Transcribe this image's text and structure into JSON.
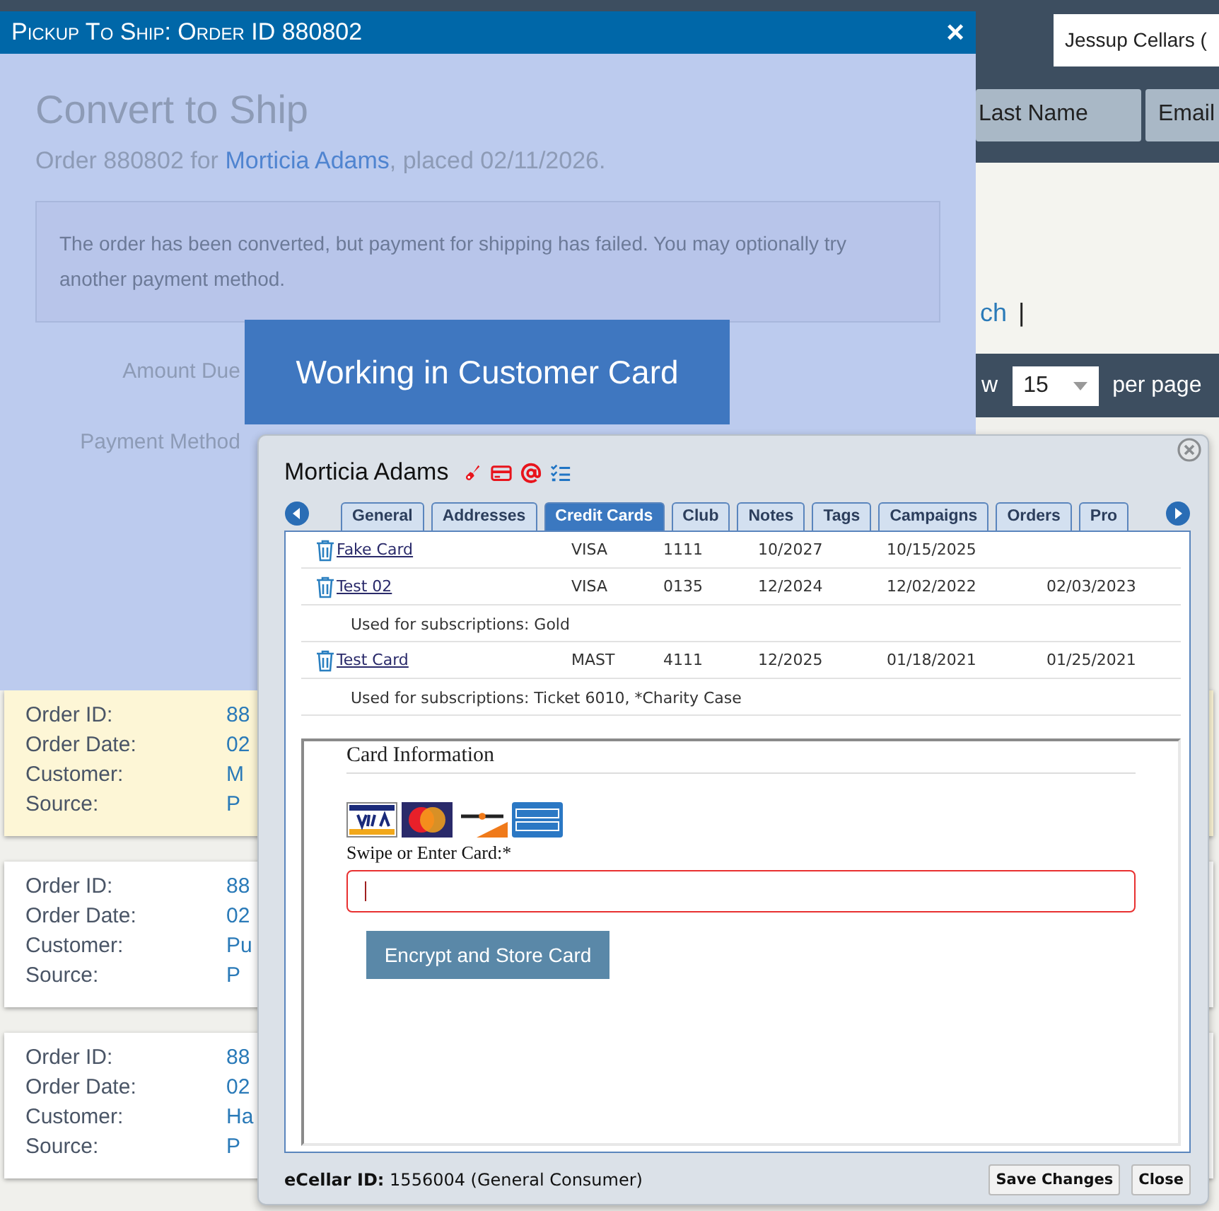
{
  "page": {
    "account_field": {
      "value": "Jessup Cellars ("
    },
    "search_tabs": [
      {
        "label": "Last Name"
      },
      {
        "label": "Email"
      }
    ],
    "link_fragment": "ch",
    "separator": "|",
    "pager": {
      "prefix": "w",
      "per_page": "15",
      "suffix": "per page"
    },
    "order_cards": [
      {
        "highlighted": true,
        "fields": [
          {
            "label": "Order ID:",
            "value": "88"
          },
          {
            "label": "Order Date:",
            "value": "02"
          },
          {
            "label": "Customer:",
            "value": "M"
          },
          {
            "label": "Source:",
            "value": "P"
          }
        ]
      },
      {
        "highlighted": false,
        "fields": [
          {
            "label": "Order ID:",
            "value": "88"
          },
          {
            "label": "Order Date:",
            "value": "02"
          },
          {
            "label": "Customer:",
            "value": "Pu"
          },
          {
            "label": "Source:",
            "value": "P"
          }
        ]
      },
      {
        "highlighted": false,
        "fields": [
          {
            "label": "Order ID:",
            "value": "88"
          },
          {
            "label": "Order Date:",
            "value": "02"
          },
          {
            "label": "Customer:",
            "value": "Ha"
          },
          {
            "label": "Source:",
            "value": "P"
          }
        ]
      }
    ]
  },
  "pickup_dialog": {
    "title": "Pickup To Ship: Order ID 880802",
    "close": "×",
    "heading": "Convert to Ship",
    "summary": {
      "before": "Order 880802 for ",
      "customer": "Morticia Adams",
      "after": ", placed 02/11/2026."
    },
    "alert": "The order has been converted, but payment for shipping has failed. You may optionally try another payment method.",
    "fields": [
      {
        "label": "Amount Due"
      },
      {
        "label": "Payment Method"
      }
    ]
  },
  "status_banner": "Working in Customer Card",
  "customer_card": {
    "name": "Morticia Adams",
    "tabs": [
      {
        "label": "General",
        "selected": false
      },
      {
        "label": "Addresses",
        "selected": false
      },
      {
        "label": "Credit Cards",
        "selected": true
      },
      {
        "label": "Club",
        "selected": false
      },
      {
        "label": "Notes",
        "selected": false
      },
      {
        "label": "Tags",
        "selected": false
      },
      {
        "label": "Campaigns",
        "selected": false
      },
      {
        "label": "Orders",
        "selected": false
      },
      {
        "label": "Pro",
        "selected": false
      }
    ],
    "cards": [
      {
        "cells": [
          "Fake Card",
          "VISA",
          "1111",
          "10/2027",
          "10/15/2025"
        ]
      },
      {
        "cells": [
          "Test 02",
          "VISA",
          "0135",
          "12/2024",
          "12/02/2022",
          "02/03/2023"
        ],
        "note": "Used for subscriptions: Gold"
      },
      {
        "cells": [
          "Test Card",
          "MAST",
          "4111",
          "12/2025",
          "01/18/2021",
          "01/25/2021"
        ],
        "note": "Used for subscriptions: Ticket 6010, *Charity Case"
      }
    ],
    "card_form": {
      "heading": "Card Information",
      "label": "Swipe or Enter Card:*",
      "button": "Encrypt and Store Card"
    },
    "footer": {
      "id_label": "eCellar ID:",
      "id_value": "1556004 (General Consumer)"
    },
    "buttons": [
      "Save Changes",
      "Close"
    ]
  }
}
